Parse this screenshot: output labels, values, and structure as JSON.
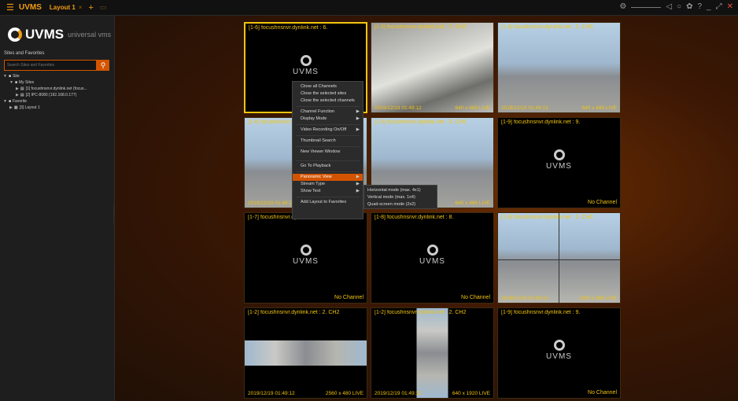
{
  "app": {
    "name": "UVMS",
    "tab_label": "Layout 1",
    "tab_close": "×",
    "tab_add": "+"
  },
  "sidebar": {
    "logo_text": "UVMS",
    "logo_sub": "universal vms",
    "section_label": "Sites and Favorites",
    "search_placeholder": "Search Sites and Favorites",
    "tree": [
      {
        "arrow": "▼",
        "label": "Site",
        "indent": 4
      },
      {
        "arrow": "▼",
        "label": "My Sites",
        "indent": 12
      },
      {
        "arrow": "▶",
        "label": "[1] focushnsnvr.dynlink.net (focus...",
        "indent": 20
      },
      {
        "arrow": "▶",
        "label": "[2] IPC-8080 (192.168.0.177)",
        "indent": 20
      },
      {
        "arrow": "▼",
        "label": "Favorite",
        "indent": 4
      },
      {
        "arrow": "▶",
        "label": "[3] Layout 1",
        "indent": 12
      }
    ]
  },
  "tiles": [
    {
      "title": "[1-6] focushnsnvr.dynlink.net : 6.",
      "footer_time": "",
      "footer_res": "",
      "no_channel": "",
      "logo": "UVMS"
    },
    {
      "title": "[1-2] focushnsnvr.dynlink.net : 2. CH2",
      "footer_time": "2019/12/19 01:49:12",
      "footer_res": "640 x 480 LIVE",
      "no_channel": ""
    },
    {
      "title": "[1-3] focushnsnvr.dynlink.net : 3. CH3",
      "footer_time": "2019/12/19 01:49:13",
      "footer_res": "640 x 480 LIVE",
      "no_channel": ""
    },
    {
      "title": "[1-4] focushnsnvr.dynlink.net : 4.",
      "footer_time": "2019/12/19 01:49:12",
      "footer_res": "",
      "no_channel": ""
    },
    {
      "title": "[1-5] focushnsnvr.dynlink.net : 5. CH5",
      "footer_time": "",
      "footer_res": "640 x 480 LIVE",
      "no_channel": ""
    },
    {
      "title": "[1-9] focushnsnvr.dynlink.net : 9.",
      "footer_time": "",
      "footer_res": "",
      "no_channel": "No Channel",
      "logo": "UVMS"
    },
    {
      "title": "[1-7] focushnsnvr.dynlink.net : 7.",
      "footer_time": "",
      "footer_res": "",
      "no_channel": "No Channel",
      "logo": "UVMS"
    },
    {
      "title": "[1-8] focushnsnvr.dynlink.net : 8.",
      "footer_time": "",
      "footer_res": "",
      "no_channel": "No Channel",
      "logo": "UVMS"
    },
    {
      "title": "[1-3] focushnsnvr.dynlink.net : 3. CH3",
      "footer_time": "2019/12/19 01:49:13",
      "footer_res": "1280 x 960 LIVE",
      "no_channel": ""
    },
    {
      "title": "[1-2] focushnsnvr.dynlink.net : 2. CH2",
      "footer_time": "2019/12/19 01:49:12",
      "footer_res": "2560 x 480 LIVE",
      "no_channel": ""
    },
    {
      "title": "[1-2] focushnsnvr.dynlink.net : 2. CH2",
      "footer_time": "2019/12/19 01:49:12",
      "footer_res": "640 x 1920 LIVE",
      "no_channel": ""
    },
    {
      "title": "[1-9] focushnsnvr.dynlink.net : 9.",
      "footer_time": "",
      "footer_res": "",
      "no_channel": "No Channel",
      "logo": "UVMS"
    }
  ],
  "context_menu": {
    "items": [
      "Close all Channels",
      "Close the selected sites",
      "Close the selected channels",
      "Channel Function",
      "Display Mode",
      "Video Recording On/Off",
      "Thumbnail Search",
      "New Viewer Window",
      "Go To Playback",
      "Panoramic View",
      "Stream Type",
      "Show Text",
      "Add Layout to Favorites"
    ],
    "submenu": [
      "Horizontal mode (max. 4x1)",
      "Vertical mode (max. 1x4)",
      "Quad-screen mode (2x2)"
    ]
  },
  "colors": {
    "accent": "#f39c12",
    "title_yellow": "#f1c40f",
    "highlight": "#d35400"
  }
}
